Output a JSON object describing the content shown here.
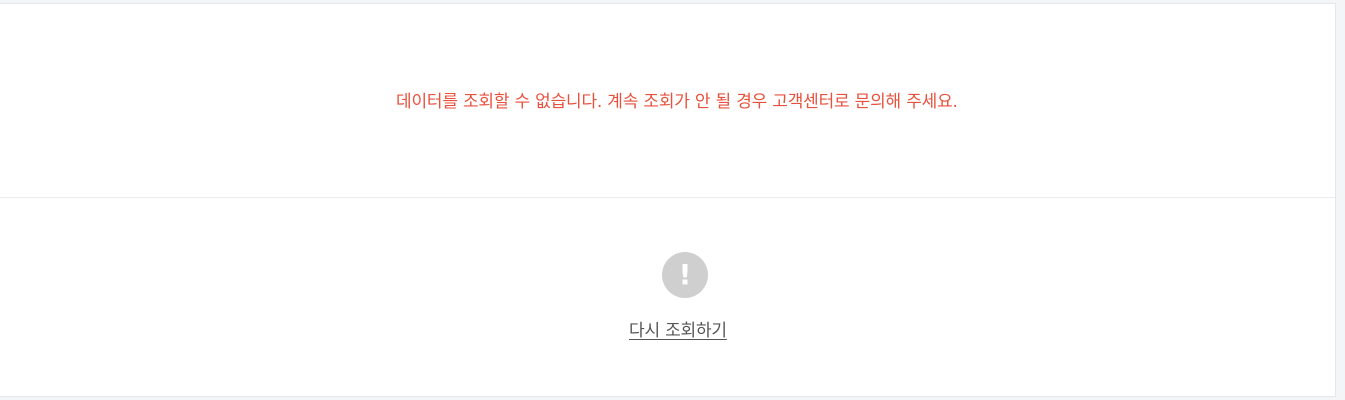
{
  "error": {
    "message": "데이터를 조회할 수 없습니다. 계속 조회가 안 될 경우 고객센터로 문의해 주세요."
  },
  "retry": {
    "icon_glyph": "!",
    "icon_name": "exclamation-circle-icon",
    "link_label": "다시 조회하기"
  },
  "colors": {
    "error_text": "#e8513d",
    "icon_background": "#cfcfcf",
    "link_text": "#555555"
  }
}
